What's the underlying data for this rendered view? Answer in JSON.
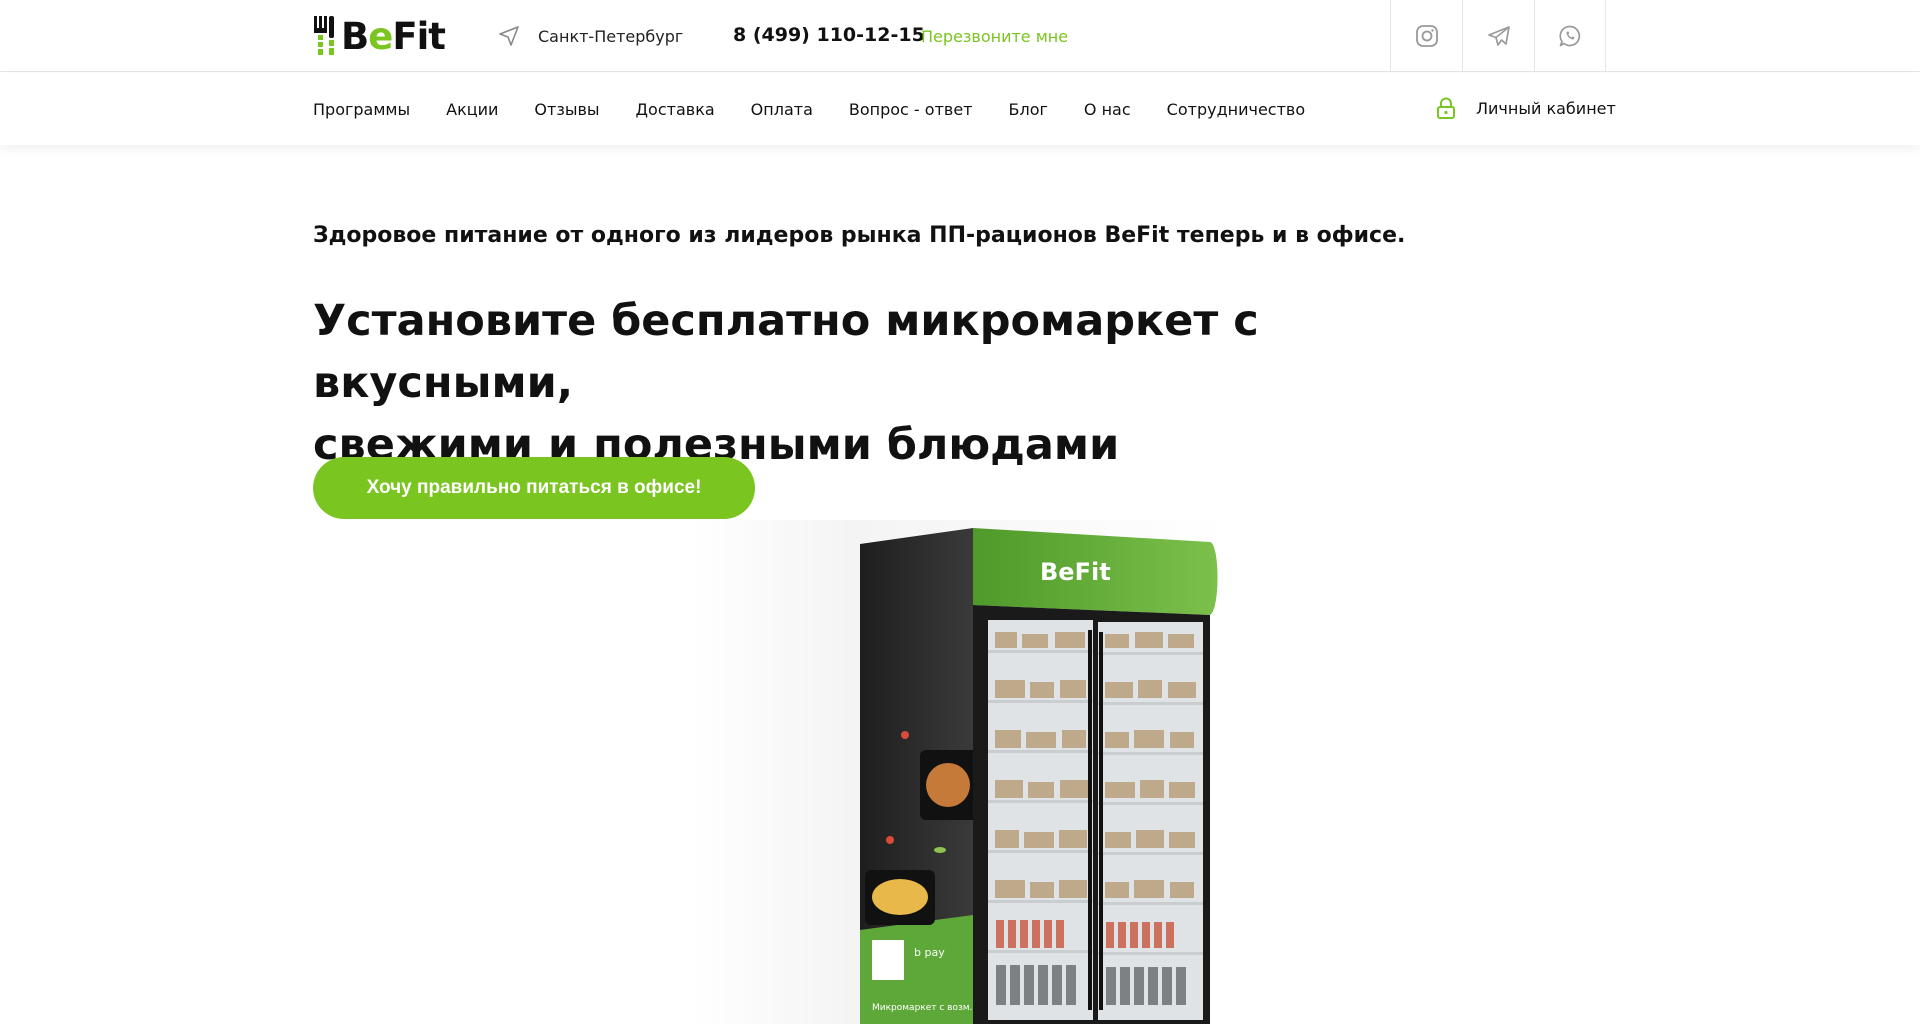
{
  "header": {
    "logo": {
      "part1": "B",
      "accent": "e",
      "part2": "Fit"
    },
    "city": "Санкт-Петербург",
    "phone": "8 (499) 110-12-15",
    "callback": "Перезвоните мне",
    "socials": [
      "instagram-icon",
      "telegram-icon",
      "whatsapp-icon"
    ]
  },
  "nav": {
    "items": [
      "Программы",
      "Акции",
      "Отзывы",
      "Доставка",
      "Оплата",
      "Вопрос - ответ",
      "Блог",
      "О нас",
      "Сотрудничество"
    ],
    "account": "Личный кабинет"
  },
  "hero": {
    "subtitle": "Здоровое питание от одного из лидеров рынка ПП-рационов BeFit теперь и в офисе.",
    "headline_line1": "Установите бесплатно микромаркет с вкусными,",
    "headline_line2": "свежими и полезными блюдами",
    "cta": "Хочу правильно питаться в офисе!"
  },
  "fridge": {
    "sign": "BeFit",
    "pay_label": "b pay",
    "side_text": "Микромаркет с возм..."
  },
  "colors": {
    "accent": "#7ac520",
    "text": "#111111",
    "border": "#e6e6e6"
  }
}
